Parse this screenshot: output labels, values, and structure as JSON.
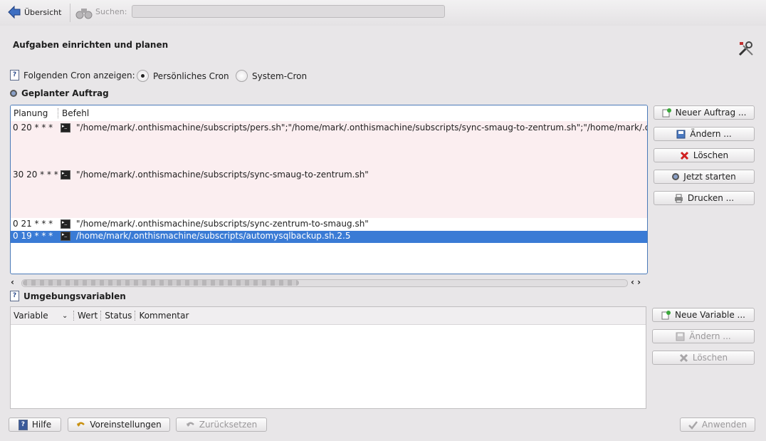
{
  "toolbar": {
    "back_label": "Übersicht",
    "search_label": "Suchen:",
    "search_value": ""
  },
  "page": {
    "title": "Aufgaben einrichten und planen"
  },
  "cron_selector": {
    "label": "Folgenden Cron anzeigen:",
    "options": [
      "Persönliches Cron",
      "System-Cron"
    ],
    "selected": "Persönliches Cron"
  },
  "jobs": {
    "section_title": "Geplanter Auftrag",
    "columns": [
      "Planung",
      "Befehl"
    ],
    "rows": [
      {
        "schedule": "0 20 * * *",
        "command": "\"/home/mark/.onthismachine/subscripts/pers.sh\";\"/home/mark/.onthismachine/subscripts/sync-smaug-to-zentrum.sh\";\"/home/mark/.onthis"
      },
      {
        "schedule": "30 20 * * *",
        "command": "\"/home/mark/.onthismachine/subscripts/sync-smaug-to-zentrum.sh\""
      },
      {
        "schedule": "0 21 * * *",
        "command": "\"/home/mark/.onthismachine/subscripts/sync-zentrum-to-smaug.sh\""
      },
      {
        "schedule": "0 19 * * *",
        "command": "/home/mark/.onthismachine/subscripts/automysqlbackup.sh.2.5"
      }
    ],
    "buttons": {
      "new": "Neuer Auftrag ...",
      "edit": "Ändern ...",
      "delete": "Löschen",
      "run": "Jetzt starten",
      "print": "Drucken ..."
    }
  },
  "env": {
    "section_title": "Umgebungsvariablen",
    "columns": [
      "Variable",
      "Wert",
      "Status",
      "Kommentar"
    ],
    "buttons": {
      "new": "Neue Variable ...",
      "edit": "Ändern ...",
      "delete": "Löschen"
    }
  },
  "footer": {
    "help": "Hilfe",
    "defaults": "Voreinstellungen",
    "reset": "Zurücksetzen",
    "apply": "Anwenden"
  },
  "colors": {
    "selection": "#3a7bd5",
    "row_pink": "#fbeef0",
    "accent_border": "#4a7ab8"
  }
}
